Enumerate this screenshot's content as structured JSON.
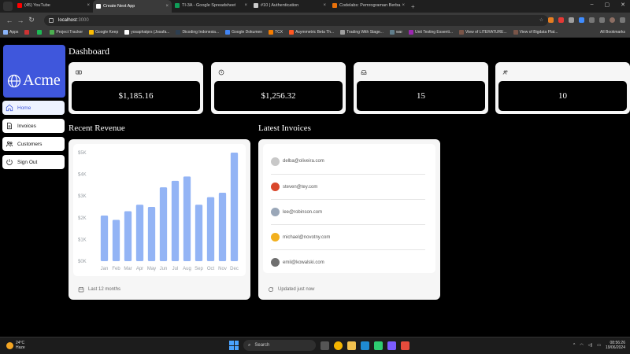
{
  "browser": {
    "tabs": [
      {
        "label": "(45) YouTube",
        "color": "#ff0000"
      },
      {
        "label": "Create Next App",
        "color": "#ffffff",
        "active": true
      },
      {
        "label": "TI-3A - Google Spreadsheet",
        "color": "#0f9d58"
      },
      {
        "label": "#10 | Authentication",
        "color": "#cccccc"
      },
      {
        "label": "Codelabs: Pemrograman Berba...",
        "color": "#e8710a"
      }
    ],
    "new_tab": "+",
    "address": {
      "host": "localhost",
      "port": ":3000"
    },
    "bookmarks": [
      {
        "label": "Apps",
        "color": "#8ab4f8"
      },
      {
        "label": "",
        "color": "#c33"
      },
      {
        "label": "",
        "color": "#1db954"
      },
      {
        "label": "Project Tracker",
        "color": "#4caf50"
      },
      {
        "label": "Google Keep",
        "color": "#fbbc04"
      },
      {
        "label": "yosaphatprs (Josafa...",
        "color": "#ffffff"
      },
      {
        "label": "Dicoding Indonesia...",
        "color": "#2d3e50"
      },
      {
        "label": "Google Dokumen",
        "color": "#4285f4"
      },
      {
        "label": "TCX",
        "color": "#f57c00"
      },
      {
        "label": "Asymmetric Beta Th...",
        "color": "#ff5722"
      },
      {
        "label": "Trading With Stage...",
        "color": "#9e9e9e"
      },
      {
        "label": "war",
        "color": "#607d8b"
      },
      {
        "label": "Unit Testing Essenti...",
        "color": "#9c27b0"
      },
      {
        "label": "View of LITERATURE...",
        "color": "#795548"
      },
      {
        "label": "View of Bigdata Plat...",
        "color": "#795548"
      }
    ],
    "all_bookmarks": "All Bookmarks"
  },
  "app": {
    "brand": "Acme",
    "nav": [
      {
        "label": "Home",
        "icon": "home-icon",
        "active": true
      },
      {
        "label": "Invoices",
        "icon": "document-icon"
      },
      {
        "label": "Customers",
        "icon": "users-icon"
      },
      {
        "label": "Sign Out",
        "icon": "power-icon"
      }
    ],
    "title": "Dashboard",
    "cards": [
      {
        "icon": "banknotes-icon",
        "value": "$1,185.16"
      },
      {
        "icon": "clock-icon",
        "value": "$1,256.32"
      },
      {
        "icon": "inbox-icon",
        "value": "15"
      },
      {
        "icon": "user-group-icon",
        "value": "10"
      }
    ],
    "revenue_title": "Recent Revenue",
    "revenue_footer": "Last 12 months",
    "invoices_title": "Latest Invoices",
    "invoices_footer": "Updated just now",
    "invoices": [
      {
        "email": "delba@oliveira.com",
        "avatar": "#c8c8c8"
      },
      {
        "email": "steven@tey.com",
        "avatar": "#d9472b"
      },
      {
        "email": "lee@robinson.com",
        "avatar": "#9aa7b8"
      },
      {
        "email": "michael@novotny.com",
        "avatar": "#f2b01e"
      },
      {
        "email": "emil@kowalski.com",
        "avatar": "#6f6f6f"
      }
    ]
  },
  "chart_data": {
    "type": "bar",
    "categories": [
      "Jan",
      "Feb",
      "Mar",
      "Apr",
      "May",
      "Jun",
      "Jul",
      "Aug",
      "Sep",
      "Oct",
      "Nov",
      "Dec"
    ],
    "values": [
      2100,
      1900,
      2300,
      2600,
      2500,
      3400,
      3700,
      3900,
      2600,
      2950,
      3150,
      5000
    ],
    "y_ticks": [
      "$5K",
      "$4K",
      "$3K",
      "$2K",
      "$1K",
      "$0K"
    ],
    "ylim": [
      0,
      5000
    ],
    "bar_color": "#93b4f5"
  },
  "taskbar": {
    "weather_temp": "24°C",
    "weather_desc": "Haze",
    "search": "Search",
    "time": "08:56:26",
    "date": "19/06/2024"
  }
}
